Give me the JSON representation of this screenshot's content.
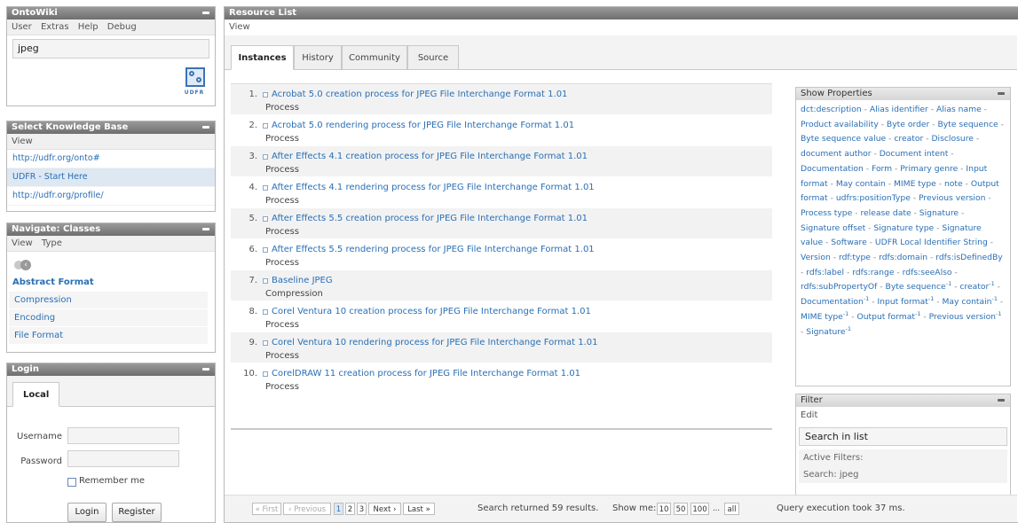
{
  "ontowiki": {
    "title": "OntoWiki",
    "menu": [
      "User",
      "Extras",
      "Help",
      "Debug"
    ],
    "search_value": "jpeg",
    "logo_text": "UDFR"
  },
  "knowledge_base": {
    "title": "Select Knowledge Base",
    "menu": [
      "View"
    ],
    "items": [
      {
        "label": "http://udfr.org/onto#",
        "selected": false
      },
      {
        "label": "UDFR - Start Here",
        "selected": true
      },
      {
        "label": "http://udfr.org/profile/",
        "selected": false
      }
    ]
  },
  "classes": {
    "title": "Navigate: Classes",
    "menu": [
      "View",
      "Type"
    ],
    "root": "Abstract Format",
    "items": [
      "Compression",
      "Encoding",
      "File Format"
    ]
  },
  "login": {
    "title": "Login",
    "tab": "Local",
    "username_label": "Username",
    "password_label": "Password",
    "remember_label": "Remember me",
    "login_button": "Login",
    "register_button": "Register"
  },
  "main": {
    "title": "Resource List",
    "menu": [
      "View"
    ],
    "tabs": [
      {
        "label": "Instances",
        "active": true
      },
      {
        "label": "History",
        "active": false
      },
      {
        "label": "Community",
        "active": false
      },
      {
        "label": "Source",
        "active": false
      }
    ],
    "resources": [
      {
        "num": "1.",
        "title": "Acrobat 5.0 creation process for JPEG File Interchange Format 1.01",
        "type": "Process"
      },
      {
        "num": "2.",
        "title": "Acrobat 5.0 rendering process for JPEG File Interchange Format 1.01",
        "type": "Process"
      },
      {
        "num": "3.",
        "title": "After Effects 4.1 creation process for JPEG File Interchange Format 1.01",
        "type": "Process"
      },
      {
        "num": "4.",
        "title": "After Effects 4.1 rendering process for JPEG File Interchange Format 1.01",
        "type": "Process"
      },
      {
        "num": "5.",
        "title": "After Effects 5.5 creation process for JPEG File Interchange Format 1.01",
        "type": "Process"
      },
      {
        "num": "6.",
        "title": "After Effects 5.5 rendering process for JPEG File Interchange Format 1.01",
        "type": "Process"
      },
      {
        "num": "7.",
        "title": "Baseline JPEG",
        "type": "Compression"
      },
      {
        "num": "8.",
        "title": "Corel Ventura 10 creation process for JPEG File Interchange Format 1.01",
        "type": "Process"
      },
      {
        "num": "9.",
        "title": "Corel Ventura 10 rendering process for JPEG File Interchange Format 1.01",
        "type": "Process"
      },
      {
        "num": "10.",
        "title": "CorelDRAW 11 creation process for JPEG File Interchange Format 1.01",
        "type": "Process"
      }
    ]
  },
  "show_properties": {
    "title": "Show Properties",
    "properties": [
      "dct:description",
      "Alias identifier",
      "Alias name",
      "Product availability",
      "Byte order",
      "Byte sequence",
      "Byte sequence value",
      "creator",
      "Disclosure",
      "document author",
      "Document intent",
      "Documentation",
      "Form",
      "Primary genre",
      "Input format",
      "May contain",
      "MIME type",
      "note",
      "Output format",
      "udfrs:positionType",
      "Previous version",
      "Process type",
      "release date",
      "Signature",
      "Signature offset",
      "Signature type",
      "Signature value",
      "Software",
      "UDFR Local Identifier String",
      "Version",
      "rdf:type",
      "rdfs:domain",
      "rdfs:isDefinedBy",
      "rdfs:label",
      "rdfs:range",
      "rdfs:seeAlso",
      "rdfs:subPropertyOf"
    ],
    "inverse_properties": [
      "Byte sequence",
      "creator",
      "Documentation",
      "Input format",
      "May contain",
      "MIME type",
      "Output format",
      "Previous version",
      "Signature"
    ],
    "inverse_marker": "-1",
    "separator": " - "
  },
  "filter": {
    "title": "Filter",
    "menu": [
      "Edit"
    ],
    "search_label": "Search in list",
    "active_label": "Active Filters:",
    "active_value": "Search: jpeg"
  },
  "pager": {
    "first": "« First",
    "previous": "‹ Previous",
    "pages": [
      "1",
      "2",
      "3"
    ],
    "current_page": "1",
    "next": "Next ›",
    "last": "Last »",
    "results": "Search returned 59 results.",
    "show_me_label": "Show me:",
    "show_options": [
      "10",
      "50",
      "100",
      "...",
      "all"
    ],
    "query_time": "Query execution took 37 ms."
  }
}
